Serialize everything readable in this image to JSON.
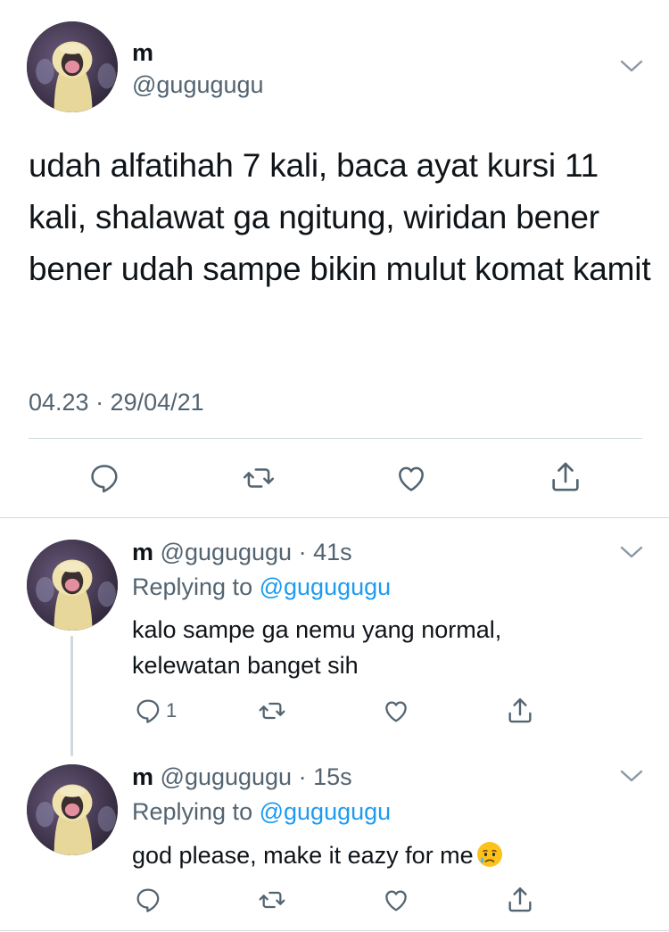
{
  "main_tweet": {
    "author_name": "m",
    "author_handle": "@gugugugu",
    "text": "udah alfatihah 7 kali, baca ayat kursi 11 kali, shalawat ga ngitung, wiridan bener bener udah sampe bikin mulut komat kamit",
    "timestamp": "04.23 · 29/04/21",
    "avatar_icon": "duck-avatar",
    "menu_icon": "chevron-down-icon"
  },
  "replies": [
    {
      "author_name": "m",
      "author_handle": "@gugugugu",
      "time_ago": "· 41s",
      "replying_prefix": "Replying to",
      "replying_to": "@gugugugu",
      "text": "kalo sampe ga nemu yang normal, kelewatan banget sih",
      "reply_count": "1",
      "emoji": ""
    },
    {
      "author_name": "m",
      "author_handle": "@gugugugu",
      "time_ago": "· 15s",
      "replying_prefix": "Replying to",
      "replying_to": "@gugugugu",
      "text": "god please, make it eazy for me",
      "reply_count": "",
      "emoji": "crying-face"
    }
  ],
  "colors": {
    "link": "#1d9bf0",
    "muted": "#536471",
    "divider": "#cfd9de",
    "text": "#0f1419"
  }
}
